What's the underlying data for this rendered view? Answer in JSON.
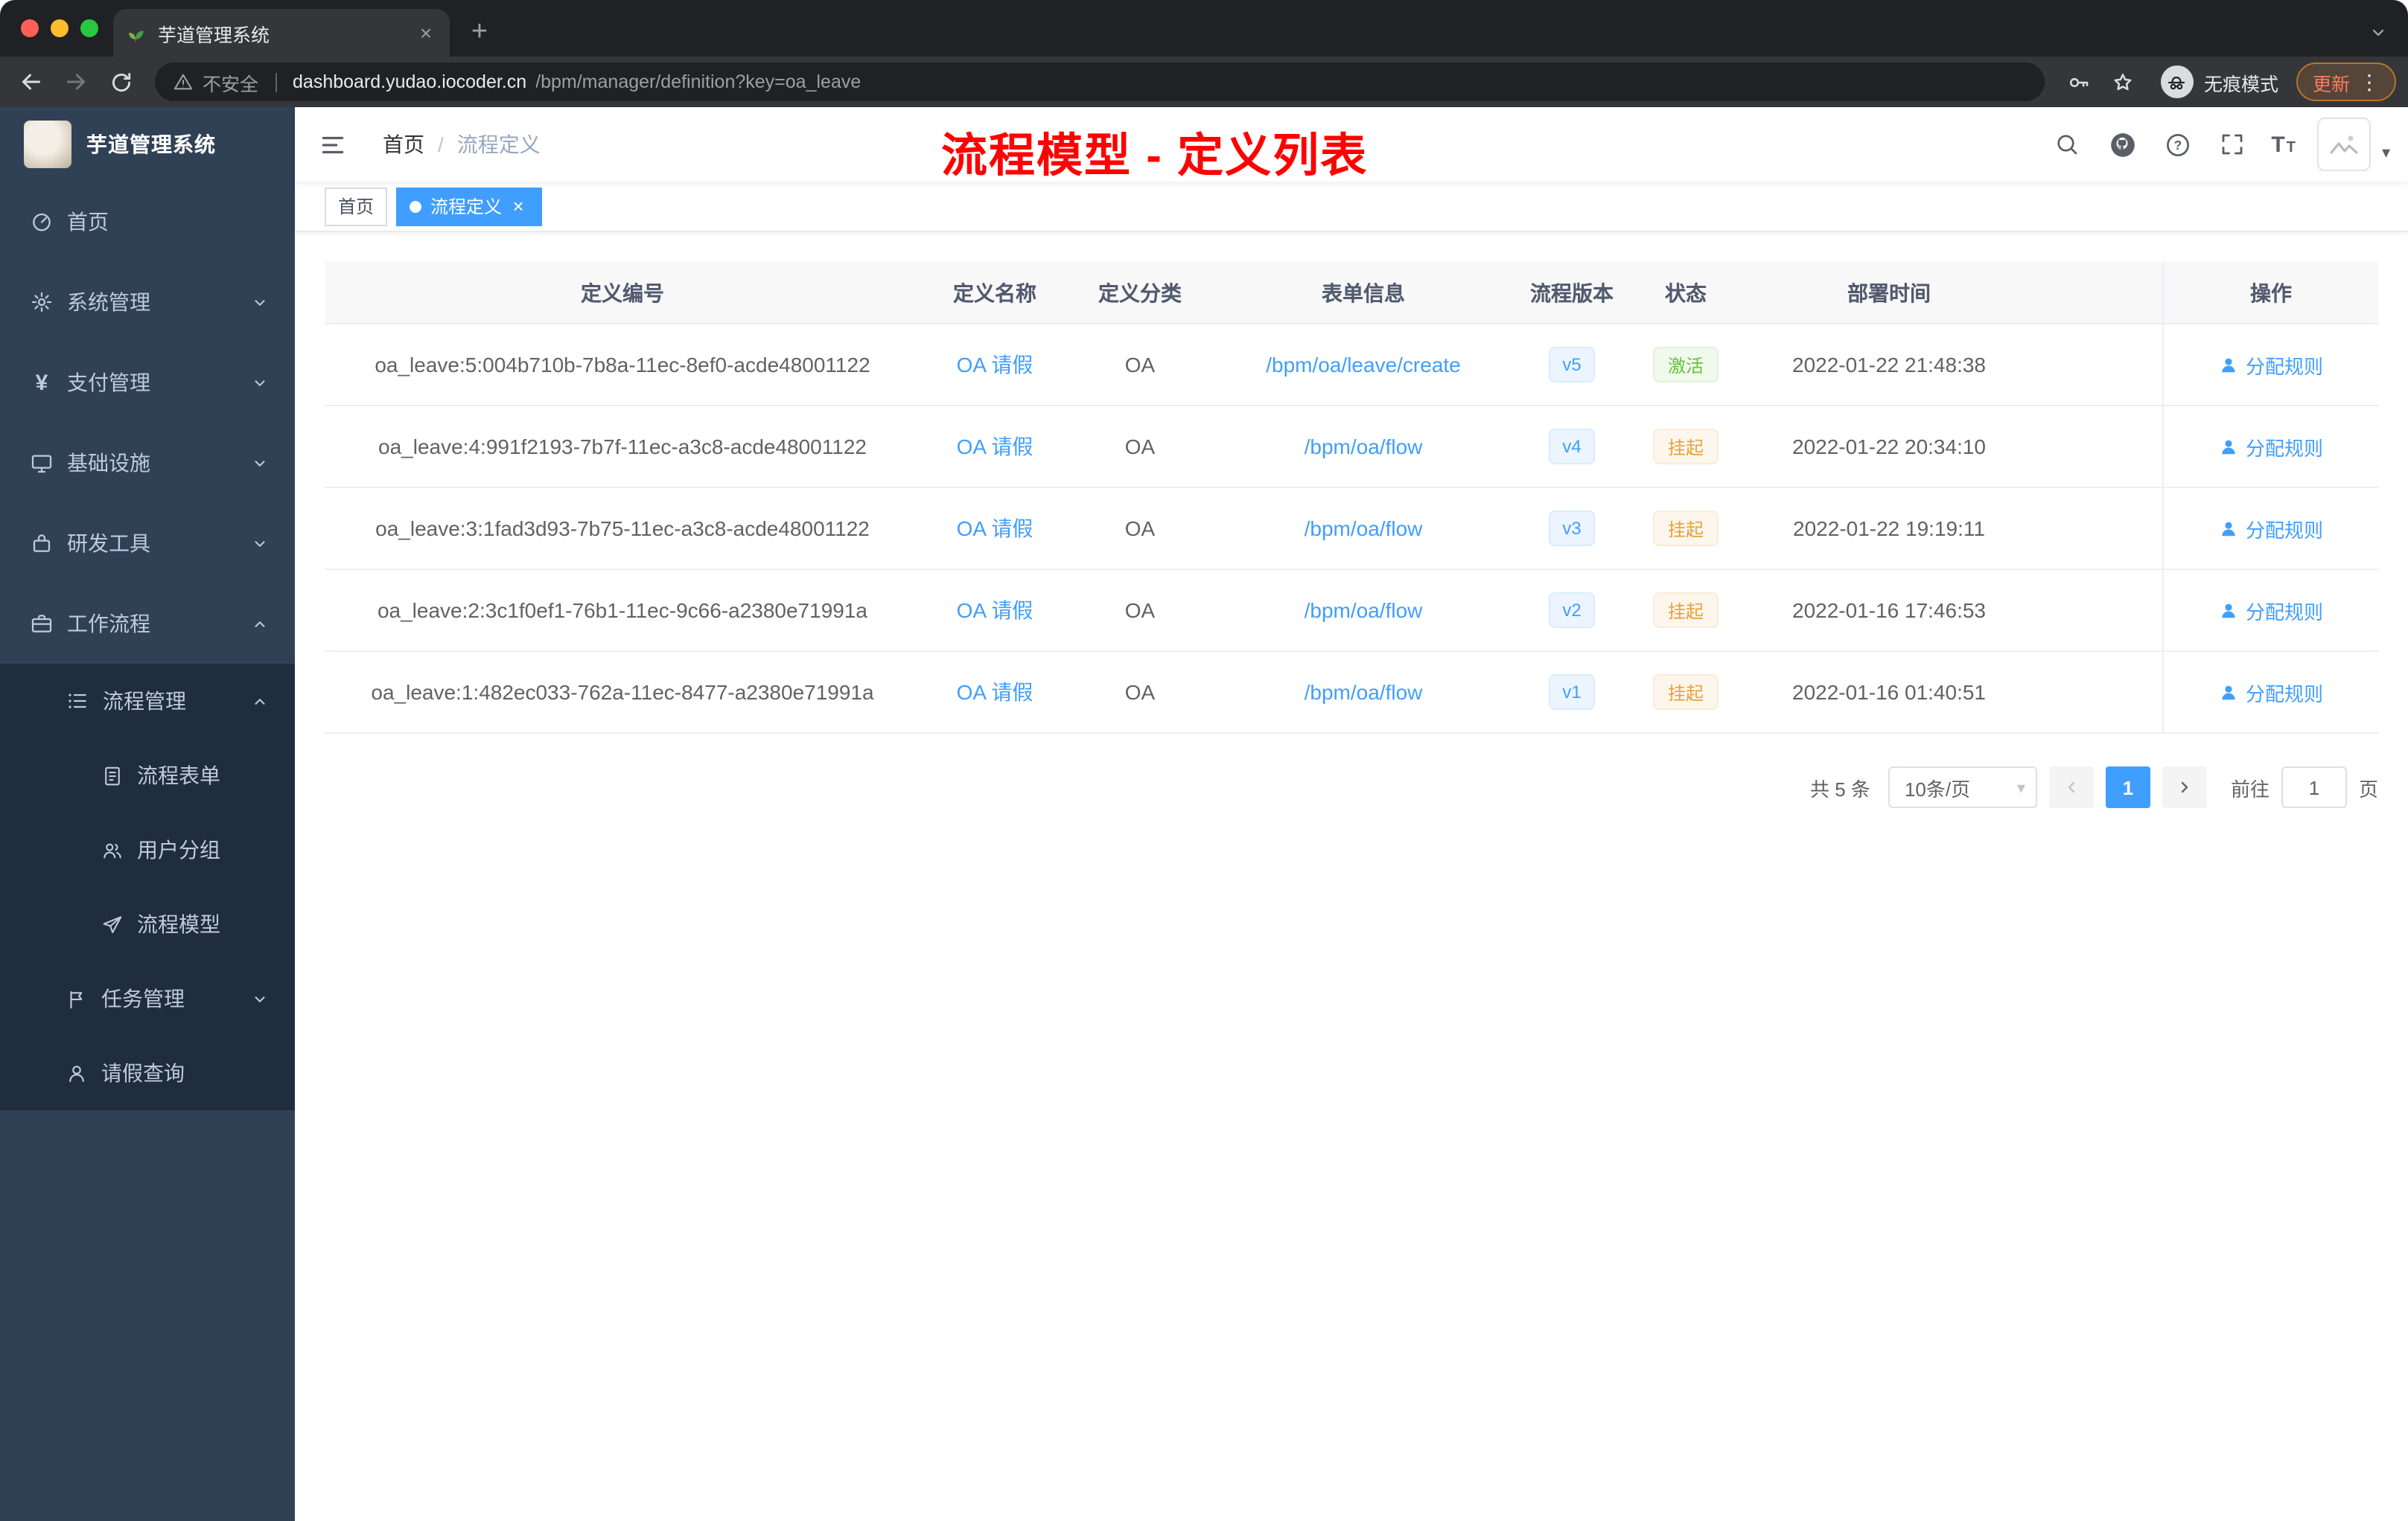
{
  "colors": {
    "accent": "#409eff",
    "success": "#67c23a",
    "warning": "#e6a23c",
    "annotation_red": "#fe0100",
    "sidebar_bg": "#304156",
    "submenu_bg": "#1f2d3d"
  },
  "icons": {
    "close": "×",
    "plus": "+",
    "caret_down": "▾",
    "kebab": "⋮",
    "question": "?",
    "font_size": "T",
    "yen": "¥"
  },
  "browser": {
    "tab_title": "芋道管理系统",
    "security_label": "不安全",
    "url_host": "dashboard.yudao.iocoder.cn",
    "url_path": "/bpm/manager/definition?key=oa_leave",
    "incognito_label": "无痕模式",
    "update_label": "更新"
  },
  "sidebar": {
    "logo_title": "芋道管理系统",
    "items": [
      {
        "label": "首页",
        "icon": "dashboard-icon"
      },
      {
        "label": "系统管理",
        "icon": "gear-icon",
        "expandable": true,
        "expanded": false
      },
      {
        "label": "支付管理",
        "icon": "yen-icon",
        "expandable": true,
        "expanded": false
      },
      {
        "label": "基础设施",
        "icon": "monitor-icon",
        "expandable": true,
        "expanded": false
      },
      {
        "label": "研发工具",
        "icon": "toolbox-icon",
        "expandable": true,
        "expanded": false
      },
      {
        "label": "工作流程",
        "icon": "briefcase-icon",
        "expandable": true,
        "expanded": true
      },
      {
        "label": "流程管理",
        "icon": "list-icon",
        "expandable": true,
        "expanded": true
      },
      {
        "label": "流程表单",
        "icon": "document-icon"
      },
      {
        "label": "用户分组",
        "icon": "users-icon"
      },
      {
        "label": "流程模型",
        "icon": "paper-plane-icon"
      },
      {
        "label": "任务管理",
        "icon": "flag-icon",
        "expandable": true,
        "expanded": false
      },
      {
        "label": "请假查询",
        "icon": "user-icon"
      }
    ]
  },
  "header": {
    "breadcrumb": [
      "首页",
      "流程定义"
    ],
    "breadcrumb_separator": "/",
    "annotation": "流程模型 - 定义列表"
  },
  "tags": [
    {
      "label": "首页",
      "active": false
    },
    {
      "label": "流程定义",
      "active": true,
      "closable": true
    }
  ],
  "table": {
    "columns": [
      "定义编号",
      "定义名称",
      "定义分类",
      "表单信息",
      "流程版本",
      "状态",
      "部署时间",
      "操作"
    ],
    "rows": [
      {
        "id": "oa_leave:5:004b710b-7b8a-11ec-8ef0-acde48001122",
        "name": "OA 请假",
        "category": "OA",
        "form": "/bpm/oa/leave/create",
        "version": "v5",
        "status": "激活",
        "status_type": "success",
        "deploy_time": "2022-01-22 21:48:38",
        "action": "分配规则"
      },
      {
        "id": "oa_leave:4:991f2193-7b7f-11ec-a3c8-acde48001122",
        "name": "OA 请假",
        "category": "OA",
        "form": "/bpm/oa/flow",
        "version": "v4",
        "status": "挂起",
        "status_type": "warning",
        "deploy_time": "2022-01-22 20:34:10",
        "action": "分配规则"
      },
      {
        "id": "oa_leave:3:1fad3d93-7b75-11ec-a3c8-acde48001122",
        "name": "OA 请假",
        "category": "OA",
        "form": "/bpm/oa/flow",
        "version": "v3",
        "status": "挂起",
        "status_type": "warning",
        "deploy_time": "2022-01-22 19:19:11",
        "action": "分配规则"
      },
      {
        "id": "oa_leave:2:3c1f0ef1-76b1-11ec-9c66-a2380e71991a",
        "name": "OA 请假",
        "category": "OA",
        "form": "/bpm/oa/flow",
        "version": "v2",
        "status": "挂起",
        "status_type": "warning",
        "deploy_time": "2022-01-16 17:46:53",
        "action": "分配规则"
      },
      {
        "id": "oa_leave:1:482ec033-762a-11ec-8477-a2380e71991a",
        "name": "OA 请假",
        "category": "OA",
        "form": "/bpm/oa/flow",
        "version": "v1",
        "status": "挂起",
        "status_type": "warning",
        "deploy_time": "2022-01-16 01:40:51",
        "action": "分配规则"
      }
    ]
  },
  "pagination": {
    "total_label": "共 5 条",
    "page_size_label": "10条/页",
    "current_page": "1",
    "goto_label": "前往",
    "goto_value": "1",
    "goto_unit": "页"
  }
}
